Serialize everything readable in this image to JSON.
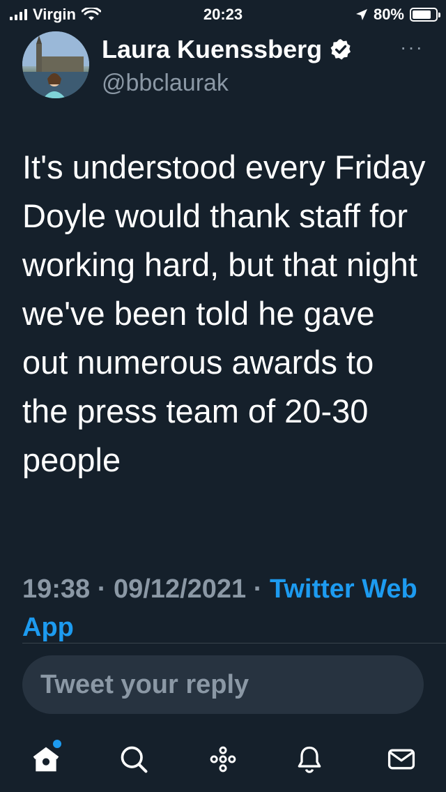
{
  "status_bar": {
    "carrier": "Virgin",
    "time": "20:23",
    "battery": "80%",
    "battery_level": 0.8
  },
  "tweet": {
    "display_name": "Laura Kuenssberg",
    "handle": "@bbclaurak",
    "verified": true,
    "more_label": "···",
    "text": "It's understood every Friday Doyle would thank staff for working hard, but that night we've been told he gave out numerous awards to the press team of 20-30 people",
    "time": "19:38",
    "separator": " · ",
    "date": "09/12/2021",
    "source": "Twitter Web App"
  },
  "reply": {
    "placeholder": "Tweet your reply"
  },
  "nav": {
    "items": [
      "home-icon",
      "search-icon",
      "spaces-icon",
      "notifications-icon",
      "messages-icon"
    ]
  },
  "colors": {
    "background": "#15202b",
    "accent": "#1d9bf0",
    "muted": "#8b98a5",
    "input_bg": "#273340"
  }
}
